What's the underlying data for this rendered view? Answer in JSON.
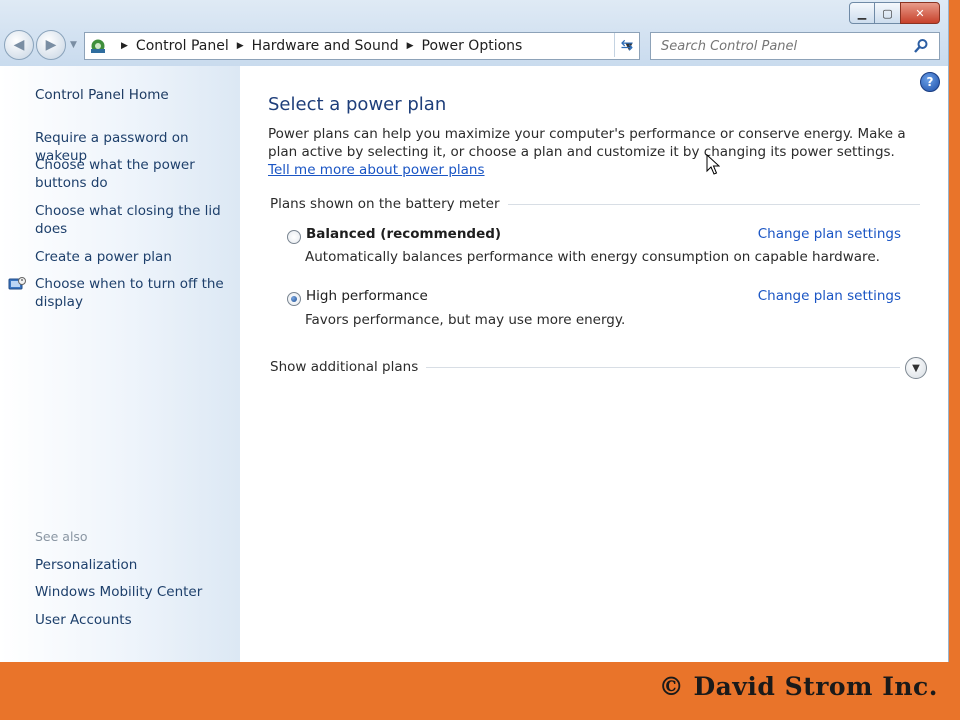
{
  "window": {
    "caption": {
      "minimize_icon": "minimize-icon",
      "maximize_icon": "maximize-icon",
      "close_icon": "close-icon"
    }
  },
  "toolbar": {
    "back_icon": "back-arrow-icon",
    "forward_icon": "forward-arrow-icon",
    "breadcrumb": [
      "Control Panel",
      "Hardware and Sound",
      "Power Options"
    ],
    "search_placeholder": "Search Control Panel",
    "refresh_icon": "refresh-icon"
  },
  "sidebar": {
    "home": "Control Panel Home",
    "links": [
      "Require a password on wakeup",
      "Choose what the power buttons do",
      "Choose what closing the lid does",
      "Create a power plan",
      "Choose when to turn off the display"
    ],
    "see_also_label": "See also",
    "see_also": [
      "Personalization",
      "Windows Mobility Center",
      "User Accounts"
    ]
  },
  "main": {
    "title": "Select a power plan",
    "intro": "Power plans can help you maximize your computer's performance or conserve energy. Make a plan active by selecting it, or choose a plan and customize it by changing its power settings.",
    "intro_link": "Tell me more about power plans",
    "plans_label": "Plans shown on the battery meter",
    "plans": [
      {
        "name": "Balanced (recommended)",
        "description": "Automatically balances performance with energy consumption on capable hardware.",
        "link": "Change plan settings",
        "selected": false
      },
      {
        "name": "High performance",
        "description": "Favors performance, but may use more energy.",
        "link": "Change plan settings",
        "selected": true
      }
    ],
    "additional_plans": "Show additional plans"
  },
  "footer": {
    "copyright": "© David Strom Inc."
  }
}
